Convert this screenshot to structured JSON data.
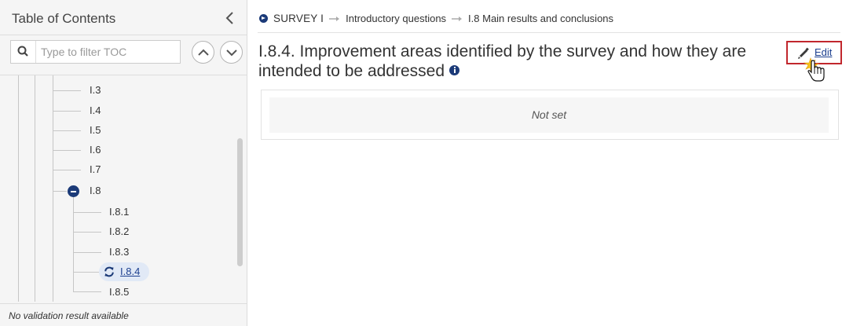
{
  "sidebar": {
    "title": "Table of Contents",
    "filter_placeholder": "Type to filter TOC",
    "tree": [
      {
        "label": "I.3"
      },
      {
        "label": "I.4"
      },
      {
        "label": "I.5"
      },
      {
        "label": "I.6"
      },
      {
        "label": "I.7"
      },
      {
        "label": "I.8",
        "expanded": true
      },
      {
        "label": "I.8.1"
      },
      {
        "label": "I.8.2"
      },
      {
        "label": "I.8.3"
      },
      {
        "label": "I.8.4",
        "active": true
      },
      {
        "label": "I.8.5"
      }
    ],
    "status": "No validation result available"
  },
  "breadcrumb": {
    "root": "SURVEY I",
    "items": [
      "Introductory questions",
      "I.8 Main results and conclusions"
    ]
  },
  "main": {
    "title": "I.8.4. Improvement areas identified by the survey and how they are intended to be addressed",
    "edit_label": "Edit",
    "value": "Not set"
  },
  "colors": {
    "accent": "#1b3a78",
    "link": "#1c3f8f",
    "highlight_border": "#c1272d",
    "active_bg": "#e1e9f6"
  }
}
